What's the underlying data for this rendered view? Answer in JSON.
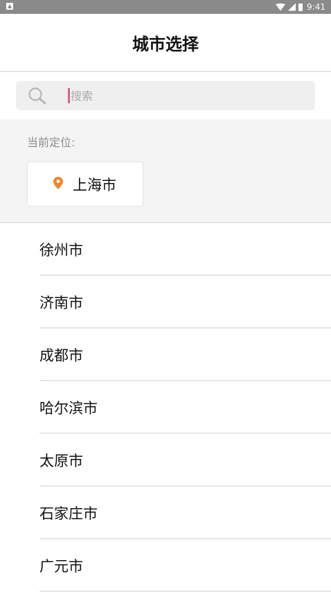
{
  "status_bar": {
    "time": "9:41"
  },
  "header": {
    "title": "城市选择"
  },
  "search": {
    "placeholder": "搜索"
  },
  "current_location": {
    "label": "当前定位:",
    "city": "上海市"
  },
  "cities": [
    "徐州市",
    "济南市",
    "成都市",
    "哈尔滨市",
    "太原市",
    "石家庄市",
    "广元市"
  ],
  "colors": {
    "accent_pin": "#f0852a",
    "cursor": "#e0608a"
  }
}
